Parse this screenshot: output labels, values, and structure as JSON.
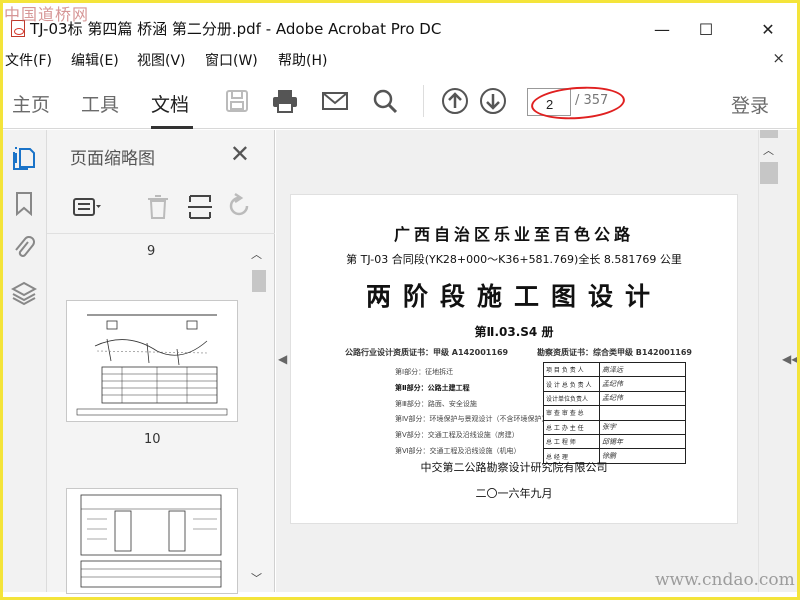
{
  "watermark_top": "中国道桥网",
  "watermark_bottom": "www.cndao.com",
  "window": {
    "title": "TJ-03标 第四篇 桥涵 第二分册.pdf - Adobe Acrobat Pro DC",
    "minimize": "—",
    "maximize": "☐",
    "close": "✕"
  },
  "menu": {
    "items": [
      "文件(F)",
      "编辑(E)",
      "视图(V)",
      "窗口(W)",
      "帮助(H)"
    ],
    "close": "×"
  },
  "toolbar": {
    "tabs": [
      "主页",
      "工具",
      "文档"
    ],
    "active_tab": "文档",
    "page_current": "2",
    "page_total": "/ 357",
    "login": "登录",
    "highlight_color": "#e02020"
  },
  "thumbnails": {
    "title": "页面缩略图",
    "close": "✕",
    "labels": [
      "9",
      "10"
    ]
  },
  "document": {
    "title1": "广西自治区乐业至百色公路",
    "title2": "第 TJ-03 合同段(YK28+000～K36+581.769)全长 8.581769 公里",
    "title3": "两阶段施工图设计",
    "title4": "第Ⅱ.03.S4 册",
    "cert_left": "公路行业设计资质证书：甲级 A142001169",
    "cert_right": "勘察资质证书：综合类甲级 B142001169",
    "parts": [
      "第Ⅰ部分：征地拆迁",
      "第Ⅱ部分：公路土建工程",
      "第Ⅲ部分：路面、安全设施",
      "第Ⅳ部分：环境保护与景观设计（不含环境保护）",
      "第Ⅴ部分：交通工程及沿线设施（房建）",
      "第Ⅵ部分：交通工程及沿线设施（机电）"
    ],
    "roles": [
      "项 目 负 责 人",
      "设 计 总 负 责 人",
      "设计单位负责人",
      "审 查 审 查 总",
      "总 工 办 主 任",
      "总   工   程   师",
      "总        经        理"
    ],
    "signatures": [
      "高泽远",
      "孟纪伟",
      "孟纪伟",
      "",
      "张宇",
      "邱锡年",
      "徐鹏"
    ],
    "company": "中交第二公路勘察设计研究院有限公司",
    "date": "二〇一六年九月"
  }
}
